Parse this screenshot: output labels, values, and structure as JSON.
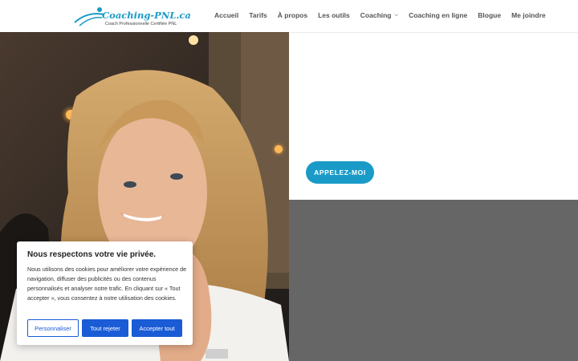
{
  "header": {
    "logo_text": "Coaching-PNL.ca",
    "logo_tagline": "Coach Professionnelle Certifiée PNL",
    "nav": [
      {
        "label": "Accueil"
      },
      {
        "label": "Tarifs"
      },
      {
        "label": "À propos"
      },
      {
        "label": "Les outils"
      },
      {
        "label": "Coaching"
      },
      {
        "label": "Coaching en ligne"
      },
      {
        "label": "Blogue"
      },
      {
        "label": "Me joindre"
      }
    ]
  },
  "hero": {
    "cta_label": "APPELEZ-MOI"
  },
  "cookie_banner": {
    "title": "Nous respectons votre vie privée.",
    "body": "Nous utilisons des cookies pour améliorer votre expérience de navigation, diffuser des publicités ou des contenus personnalisés et analyser notre trafic. En cliquant sur « Tout accepter », vous consentez à notre utilisation des cookies.",
    "customize_label": "Personnaliser",
    "reject_label": "Tout rejeter",
    "accept_label": "Accepter tout"
  },
  "colors": {
    "brand": "#1a9bc7",
    "cookie_button": "#1a5bd6",
    "gray_panel": "#666666"
  }
}
